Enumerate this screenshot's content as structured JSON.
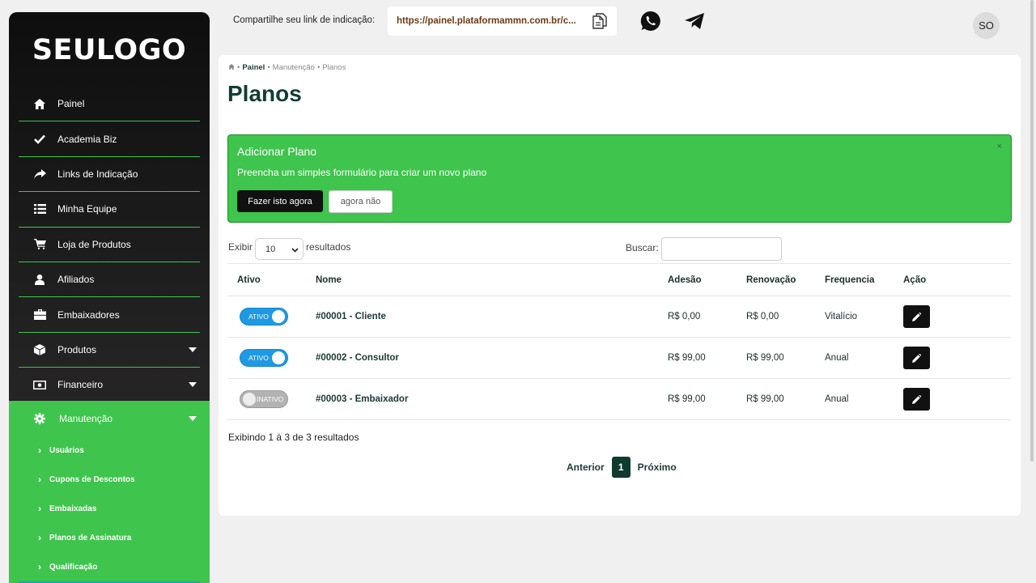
{
  "sidebar": {
    "logo": "SEULOGO",
    "items": [
      {
        "label": "Painel",
        "icon": "home-icon"
      },
      {
        "label": "Academia Biz",
        "icon": "check-icon"
      },
      {
        "label": "Links de Indicação",
        "icon": "share-icon"
      },
      {
        "label": "Minha Equipe",
        "icon": "list-icon"
      },
      {
        "label": "Loja de Produtos",
        "icon": "cart-icon"
      },
      {
        "label": "Afiliados",
        "icon": "user-icon"
      },
      {
        "label": "Embaixadores",
        "icon": "briefcase-icon"
      },
      {
        "label": "Produtos",
        "icon": "box-icon"
      },
      {
        "label": "Financeiro",
        "icon": "money-icon"
      }
    ],
    "active": {
      "label": "Manutenção",
      "icon": "gear-icon",
      "subitems": [
        "Usuários",
        "Cupons de Descontos",
        "Embaixadas",
        "Planos de Assinatura",
        "Qualificação"
      ]
    }
  },
  "topbar": {
    "share_label": "Compartilhe seu link de indicação:",
    "share_link": "https://painel.plataformammn.com.br/c...",
    "avatar": "SO"
  },
  "breadcrumb": {
    "root": "Painel",
    "section": "Manutenção",
    "current": "Planos",
    "separator": "•"
  },
  "page": {
    "title": "Planos"
  },
  "alert": {
    "title": "Adicionar Plano",
    "text": "Preencha um simples formulário para criar um novo plano",
    "primary_button": "Fazer isto agora",
    "secondary_button": "agora não",
    "close": "×"
  },
  "table_controls": {
    "show_label": "Exibir",
    "page_size": "10",
    "results_label": "resultados",
    "search_label": "Buscar:",
    "search_value": ""
  },
  "table": {
    "headers": [
      "Ativo",
      "Nome",
      "Adesão",
      "Renovação",
      "Frequencia",
      "Ação"
    ],
    "rows": [
      {
        "status": "ATIVO",
        "active": true,
        "name": "#00001 - Cliente",
        "adesao": "R$ 0,00",
        "renovacao": "R$ 0,00",
        "frequencia": "Vitalício"
      },
      {
        "status": "ATIVO",
        "active": true,
        "name": "#00002 - Consultor",
        "adesao": "R$ 99,00",
        "renovacao": "R$ 99,00",
        "frequencia": "Anual"
      },
      {
        "status": "INATIVO",
        "active": false,
        "name": "#00003 - Embaixador",
        "adesao": "R$ 99,00",
        "renovacao": "R$ 99,00",
        "frequencia": "Anual"
      }
    ]
  },
  "footer": {
    "info": "Exibindo 1 à 3 de 3 resultados",
    "prev": "Anterior",
    "page": "1",
    "next": "Próximo"
  },
  "colors": {
    "accent_green": "#3fc44d",
    "dark_green": "#123d33",
    "toggle_blue": "#1d9ae3"
  }
}
